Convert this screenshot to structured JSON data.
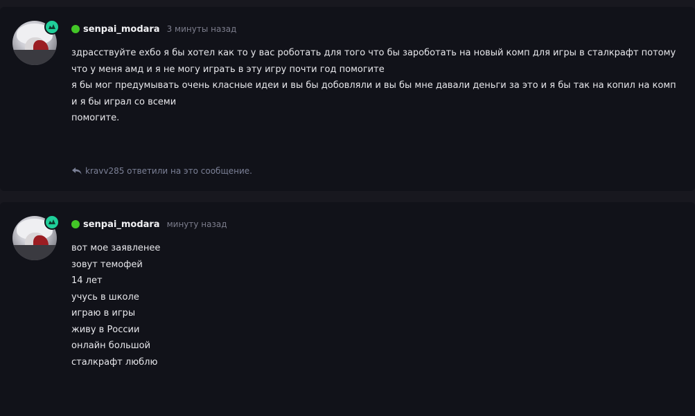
{
  "colors": {
    "background": "#18181f",
    "card": "#111219",
    "online": "#43c627",
    "badge": "#1fcf9a",
    "muted": "#7c7d8c"
  },
  "messages": [
    {
      "username": "senpai_modara",
      "time": "3 минуты назад",
      "lines": [
        "здрасствуйте ехбо я бы хотел как то у вас роботать для того что бы зароботать на новый комп для игры в сталкрафт потому что у меня амд и я не могу играть в эту игру почти год помогите",
        "я бы мог предумывать очень класные идеи и вы бы добовляли и вы бы мне давали деньги за это и я бы так на копил на комп и я бы играл со всеми",
        "помогите."
      ],
      "reply_text": "kravv285 ответили на это сообщение."
    },
    {
      "username": "senpai_modara",
      "time": "минуту назад",
      "lines": [
        "вот мое заявленее",
        "зовут темофей",
        "14 лет",
        "учусь в школе",
        "играю в игры",
        "живу в России",
        "онлайн большой",
        "сталкрафт люблю"
      ]
    }
  ]
}
